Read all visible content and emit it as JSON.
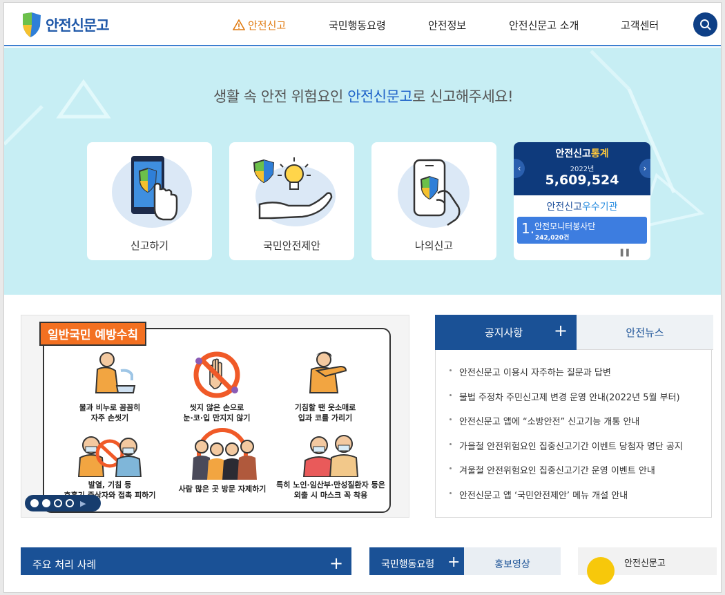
{
  "header": {
    "logo_text": "안전신문고",
    "nav": [
      "안전신고",
      "국민행동요령",
      "안전정보",
      "안전신문고 소개",
      "고객센터"
    ]
  },
  "hero": {
    "title_pre": "생활 속 안전 위험요인 ",
    "title_hl": "안전신문고",
    "title_post": "로 신고해주세요!",
    "cards": [
      "신고하기",
      "국민안전제안",
      "나의신고"
    ],
    "stats": {
      "title_a": "안전신고",
      "title_b": "통계",
      "year": "2022년",
      "count": "5,609,524",
      "org_title_a": "안전신고",
      "org_title_b": "우수기관",
      "org_rank": "1.",
      "org_name": "안전모니터봉사단",
      "org_count": "242,020건"
    }
  },
  "poster": {
    "tag": "일반국민 예방수칙",
    "rules": [
      "물과 비누로 꼼꼼히\n자주 손씻기",
      "씻지 않은 손으로\n눈·코·입 만지지 않기",
      "기침할 땐 옷소매로\n입과 코를 가리기",
      "발열, 기침 등\n호흡기 증상자와 접촉 피하기",
      "사람 많은 곳 방문 자제하기",
      "특히 노인·임산부·만성질환자 등은\n외출 시 마스크 꼭 착용"
    ]
  },
  "notice": {
    "tab_active": "공지사항",
    "tab_other": "안전뉴스",
    "items": [
      "안전신문고 이용시 자주하는 질문과 답변",
      "불법 주정차 주민신고제 변경 운영 안내(2022년 5월 부터)",
      "안전신문고 앱에 “소방안전” 신고기능 개통 안내",
      "가을철 안전위험요인 집중신고기간 이벤트 당첨자 명단 공지",
      "겨울철 안전위험요인 집중신고기간 운영 이벤트 안내",
      "안전신문고 앱 ‘국민안전제안’ 메뉴 개설 안내"
    ]
  },
  "bottom": {
    "cases": "주요 처리 사례",
    "guide": "국민행동요령",
    "video": "홍보영상",
    "kakao": "안전신문고"
  },
  "colors": {
    "navy": "#1a5196",
    "accent": "#e07a10",
    "hero_bg": "#c7eef4"
  }
}
